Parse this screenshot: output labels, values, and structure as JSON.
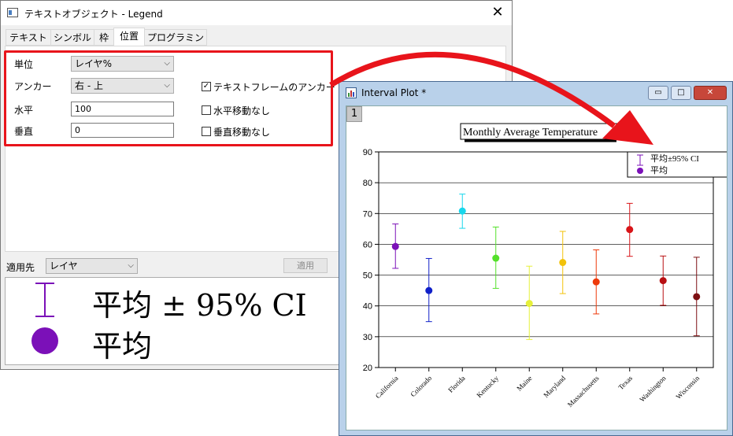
{
  "dialog": {
    "title": "テキストオブジェクト - Legend",
    "close_glyph": "✕",
    "tabs": [
      {
        "label": "テキスト"
      },
      {
        "label": "シンボル"
      },
      {
        "label": "枠"
      },
      {
        "label": "位置"
      },
      {
        "label": "プログラミング"
      }
    ],
    "active_tab": "位置",
    "fields": {
      "unit_label": "単位",
      "unit_value": "レイヤ%",
      "anchor_label": "アンカー",
      "anchor_value": "右 - 上",
      "horizontal_label": "水平",
      "horizontal_value": "100",
      "vertical_label": "垂直",
      "vertical_value": "0"
    },
    "checkboxes": {
      "text_frame_anchor": {
        "label": "テキストフレームのアンカー",
        "checked": true
      },
      "no_horizontal_move": {
        "label": "水平移動なし",
        "checked": false
      },
      "no_vertical_move": {
        "label": "垂直移動なし",
        "checked": false
      }
    },
    "apply_to_label": "適用先",
    "apply_to_value": "レイヤ",
    "apply_button": "適用",
    "preview": {
      "line1": "平均 ± 95% CI",
      "line2": "平均",
      "accent_color": "#7b10b8"
    },
    "highlight_color": "#e8141b"
  },
  "plot_window": {
    "title": "Interval Plot *",
    "layer_number": "1",
    "buttons": {
      "minimize": "▭",
      "maximize": "□",
      "close": "✕"
    }
  },
  "chart_data": {
    "type": "scatter",
    "title": "Monthly Average Temperature",
    "xlabel": "",
    "ylabel": "",
    "ylim": [
      20,
      90
    ],
    "yticks": [
      20,
      30,
      40,
      50,
      60,
      70,
      80,
      90
    ],
    "grid": true,
    "legend_position": "top-right",
    "legend": [
      {
        "label": "平均±95% CI",
        "marker": "errorbar",
        "color": "#7b10b8"
      },
      {
        "label": "平均",
        "marker": "circle",
        "color": "#7b10b8"
      }
    ],
    "categories": [
      "California",
      "Colorado",
      "Florida",
      "Kentucky",
      "Maine",
      "Maryland",
      "Massachusetts",
      "Texas",
      "Washington",
      "Wisconsin"
    ],
    "mean": [
      59.3,
      45.0,
      70.8,
      55.5,
      40.8,
      54.1,
      47.8,
      64.8,
      48.2,
      43.0
    ],
    "ci_low": [
      52.2,
      34.9,
      65.2,
      45.7,
      29.1,
      44.0,
      37.4,
      56.1,
      40.2,
      30.3
    ],
    "ci_high": [
      66.6,
      55.4,
      76.3,
      65.6,
      52.9,
      64.2,
      58.2,
      73.3,
      56.2,
      55.8
    ],
    "colors": [
      "#7b10b8",
      "#1020c8",
      "#19d7ec",
      "#54e02a",
      "#e6f03a",
      "#f2c20a",
      "#ee3a0b",
      "#d81418",
      "#b80f12",
      "#7d0f12"
    ]
  }
}
